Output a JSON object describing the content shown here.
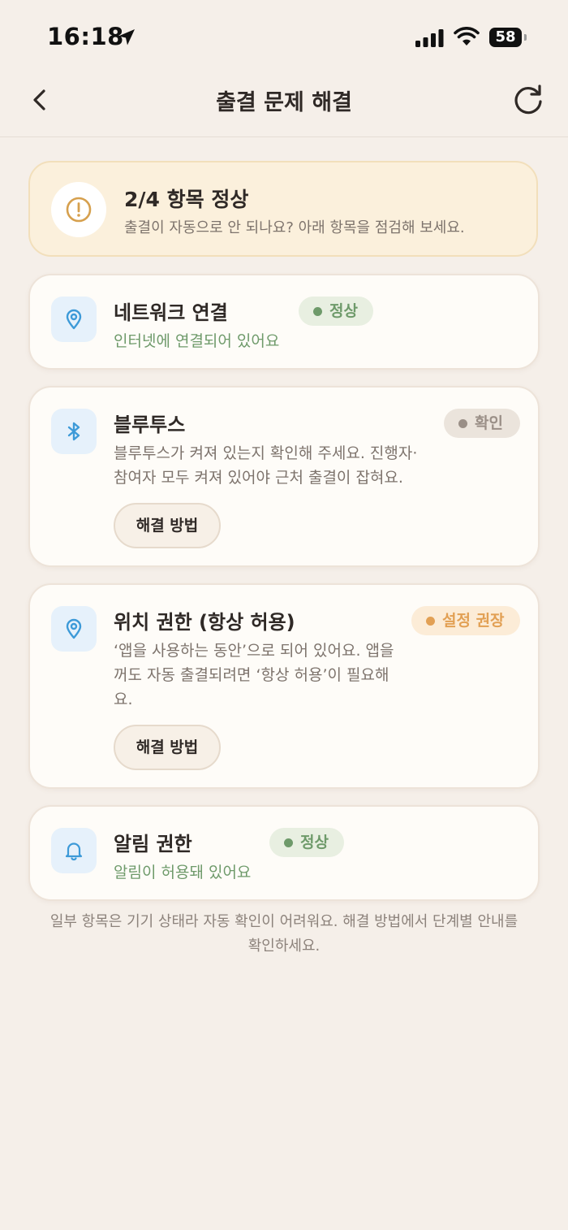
{
  "status_bar": {
    "time": "16:18",
    "battery": "58"
  },
  "nav": {
    "title": "출결 문제 해결"
  },
  "summary": {
    "title": "2/4 항목 정상",
    "subtitle": "출결이 자동으로 안 되나요? 아래 항목을 점검해 보세요."
  },
  "items": [
    {
      "title": "네트워크 연결",
      "desc": "인터넷에 연결되어 있어요",
      "badge": "정상",
      "icon": "location-pin-icon"
    },
    {
      "title": "블루투스",
      "desc_lines": [
        "블루투스가 켜져 있는지 확인해 주세요. 진행자·",
        "참여자 모두 켜져 있어야 근처 출결이 잡혀요."
      ],
      "badge": "확인",
      "action": "해결 방법",
      "icon": "bluetooth-icon"
    },
    {
      "title": "위치 권한 (항상 허용)",
      "desc_lines": [
        "‘앱을 사용하는 동안’으로 되어 있어요. 앱을",
        "꺼도 자동 출결되려면 ‘항상 허용’이 필요해",
        "요."
      ],
      "badge": "설정 권장",
      "action": "해결 방법",
      "icon": "location-pin-icon"
    },
    {
      "title": "알림 권한",
      "desc": "알림이 허용돼 있어요",
      "badge": "정상",
      "icon": "bell-icon"
    }
  ],
  "footnote_lines": [
    "일부 항목은 기기 상태라 자동 확인이 어려워요. 해결 방법에서 단계별 안내를",
    "확인하세요."
  ],
  "colors": {
    "background": "#f5efe9",
    "ok": "#6e9a6a",
    "warn": "#e2a054",
    "icon_blue": "#3d9ad8"
  }
}
